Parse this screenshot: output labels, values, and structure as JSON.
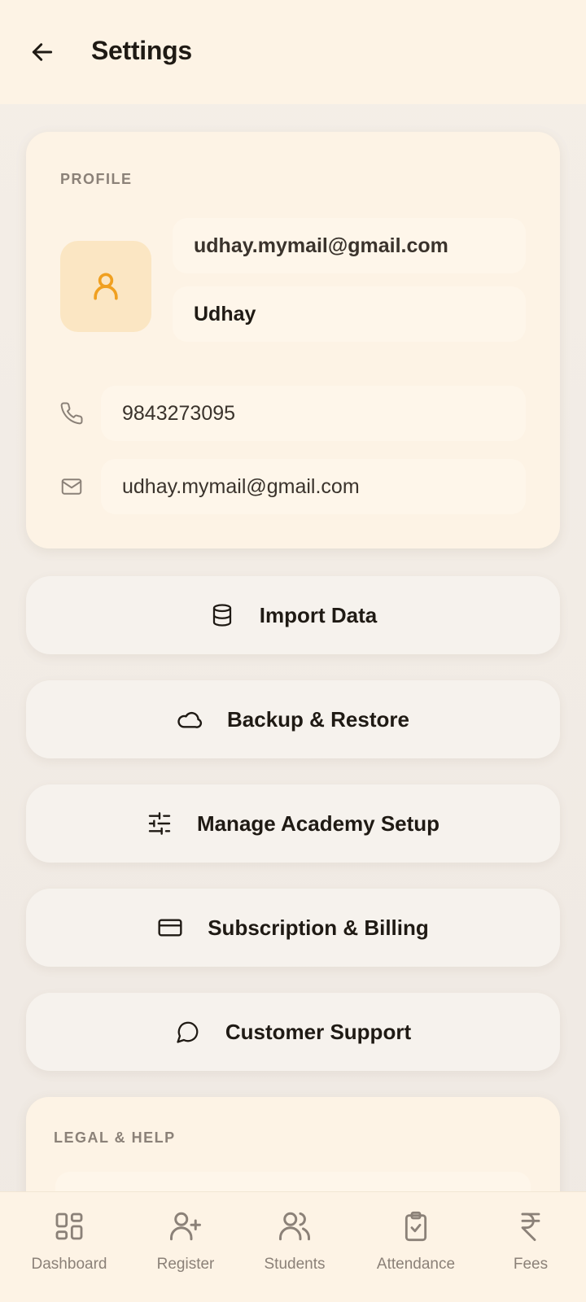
{
  "header": {
    "title": "Settings",
    "back_icon": "arrow-left-icon"
  },
  "profile": {
    "section_label": "PROFILE",
    "avatar_icon": "user-icon",
    "email_display": "udhay.mymail@gmail.com",
    "name": "Udhay",
    "phone": "9843273095",
    "email": "udhay.mymail@gmail.com"
  },
  "actions": [
    {
      "label": "Import Data",
      "icon": "database-icon"
    },
    {
      "label": "Backup & Restore",
      "icon": "cloud-icon"
    },
    {
      "label": "Manage Academy Setup",
      "icon": "sliders-icon"
    },
    {
      "label": "Subscription & Billing",
      "icon": "credit-card-icon"
    },
    {
      "label": "Customer Support",
      "icon": "chat-bubble-icon"
    }
  ],
  "legal": {
    "section_label": "LEGAL & HELP"
  },
  "nav": [
    {
      "label": "Dashboard",
      "icon": "grid-icon"
    },
    {
      "label": "Register",
      "icon": "user-plus-icon"
    },
    {
      "label": "Students",
      "icon": "users-icon"
    },
    {
      "label": "Attendance",
      "icon": "clipboard-check-icon"
    },
    {
      "label": "Fees",
      "icon": "rupee-icon"
    }
  ],
  "colors": {
    "accent": "#f0a020",
    "background": "#f0ebe5",
    "card": "#fdf3e5",
    "muted_text": "#8b8178"
  }
}
